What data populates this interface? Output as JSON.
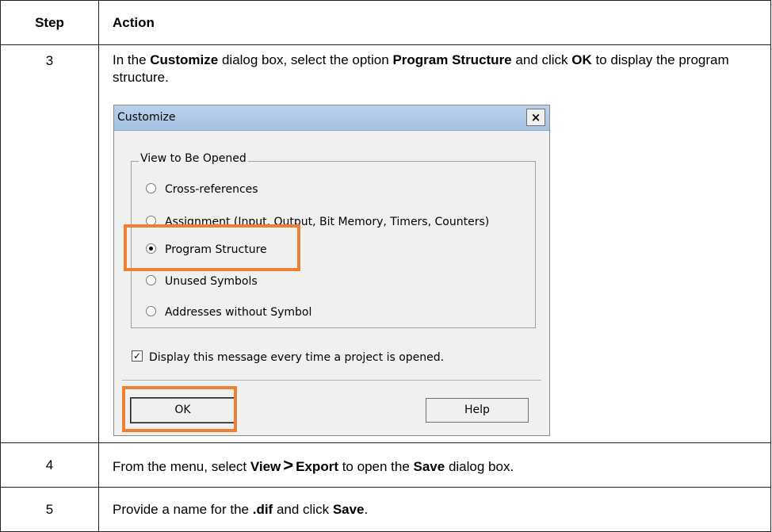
{
  "table": {
    "header": {
      "step": "Step",
      "action": "Action"
    },
    "rows": [
      {
        "step": "3",
        "text": [
          "In the ",
          "Customize",
          " dialog box, select the option ",
          "Program Structure",
          " and click ",
          "OK",
          " to display the program structure."
        ]
      },
      {
        "step": "4",
        "text": [
          "From the menu, select ",
          "View",
          ">",
          "Export",
          " to open the ",
          "Save",
          " dialog box."
        ]
      },
      {
        "step": "5",
        "text": [
          "Provide a name for the ",
          ".dif",
          " and click ",
          "Save",
          "."
        ]
      }
    ]
  },
  "dialog": {
    "title": "Customize",
    "close_glyph": "×",
    "group_label": "View to Be Opened",
    "options": [
      {
        "label": "Cross-references",
        "selected": false
      },
      {
        "label": "Assignment (Input, Output, Bit Memory, Timers, Counters)",
        "selected": false
      },
      {
        "label": "Program Structure",
        "selected": true
      },
      {
        "label": "Unused Symbols",
        "selected": false
      },
      {
        "label": "Addresses without Symbol",
        "selected": false
      }
    ],
    "checkbox_label": "Display this message every time a project is opened.",
    "checkbox_checked": true,
    "checkbox_glyph": "✓",
    "ok_label": "OK",
    "help_label": "Help"
  },
  "colors": {
    "highlight": "#f07f32",
    "titlebar": "#b9d1ea",
    "dialog_bg": "#f0f0f0"
  }
}
